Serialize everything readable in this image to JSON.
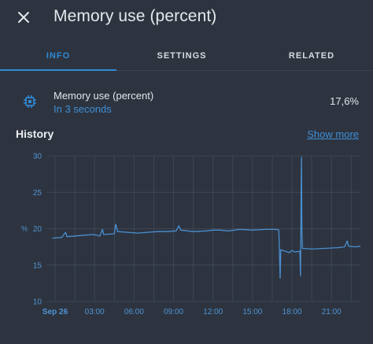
{
  "header": {
    "title": "Memory use (percent)",
    "close_icon": "close-icon"
  },
  "tabs": [
    {
      "label": "INFO",
      "active": true
    },
    {
      "label": "SETTINGS",
      "active": false
    },
    {
      "label": "RELATED",
      "active": false
    }
  ],
  "entity": {
    "icon": "chip-icon",
    "name": "Memory use (percent)",
    "last_changed": "In 3 seconds",
    "value": "17,6%"
  },
  "history": {
    "title": "History",
    "show_more": "Show more"
  },
  "colors": {
    "background": "#2d3440",
    "accent": "#2f89d4",
    "line": "#4a8fd0",
    "grid": "#3e4654"
  },
  "chart_data": {
    "type": "line",
    "ylabel": "%",
    "ylim": [
      10,
      30
    ],
    "yticks": [
      10,
      15,
      20,
      25,
      30
    ],
    "xlim": [
      -0.6,
      23.2
    ],
    "xticks": [
      {
        "x": 0,
        "label": "Sep 26",
        "bold": true
      },
      {
        "x": 3,
        "label": "03:00"
      },
      {
        "x": 6,
        "label": "06:00"
      },
      {
        "x": 9,
        "label": "09:00"
      },
      {
        "x": 12,
        "label": "12:00"
      },
      {
        "x": 15,
        "label": "15:00"
      },
      {
        "x": 18,
        "label": "18:00"
      },
      {
        "x": 21,
        "label": "21:00"
      }
    ],
    "series": [
      {
        "values": [
          [
            -0.2,
            18.7
          ],
          [
            0.5,
            18.8
          ],
          [
            0.8,
            19.5
          ],
          [
            0.9,
            18.9
          ],
          [
            1.5,
            19.0
          ],
          [
            2.2,
            19.1
          ],
          [
            2.9,
            19.2
          ],
          [
            3.4,
            19.0
          ],
          [
            3.6,
            19.9
          ],
          [
            3.7,
            19.2
          ],
          [
            4.5,
            19.3
          ],
          [
            4.6,
            20.6
          ],
          [
            4.75,
            19.6
          ],
          [
            5.5,
            19.5
          ],
          [
            6.3,
            19.4
          ],
          [
            7.0,
            19.5
          ],
          [
            7.8,
            19.6
          ],
          [
            8.5,
            19.6
          ],
          [
            9.2,
            19.7
          ],
          [
            9.4,
            20.4
          ],
          [
            9.55,
            19.8
          ],
          [
            10.5,
            19.6
          ],
          [
            11.5,
            19.7
          ],
          [
            12.0,
            19.8
          ],
          [
            12.5,
            19.8
          ],
          [
            13.2,
            19.7
          ],
          [
            14.0,
            19.9
          ],
          [
            15.0,
            19.8
          ],
          [
            16.0,
            19.9
          ],
          [
            16.8,
            19.9
          ],
          [
            17.0,
            19.8
          ],
          [
            17.05,
            16.4
          ],
          [
            17.1,
            13.2
          ],
          [
            17.15,
            17.1
          ],
          [
            17.5,
            16.9
          ],
          [
            17.8,
            16.7
          ],
          [
            18.0,
            17.0
          ],
          [
            18.2,
            16.8
          ],
          [
            18.6,
            16.9
          ],
          [
            18.65,
            13.5
          ],
          [
            18.7,
            25.9
          ],
          [
            18.72,
            29.8
          ],
          [
            18.75,
            19.9
          ],
          [
            18.8,
            17.3
          ],
          [
            19.5,
            17.2
          ],
          [
            20.5,
            17.3
          ],
          [
            21.5,
            17.4
          ],
          [
            22.0,
            17.5
          ],
          [
            22.2,
            18.3
          ],
          [
            22.3,
            17.6
          ],
          [
            22.8,
            17.5
          ],
          [
            23.2,
            17.6
          ]
        ]
      }
    ]
  }
}
